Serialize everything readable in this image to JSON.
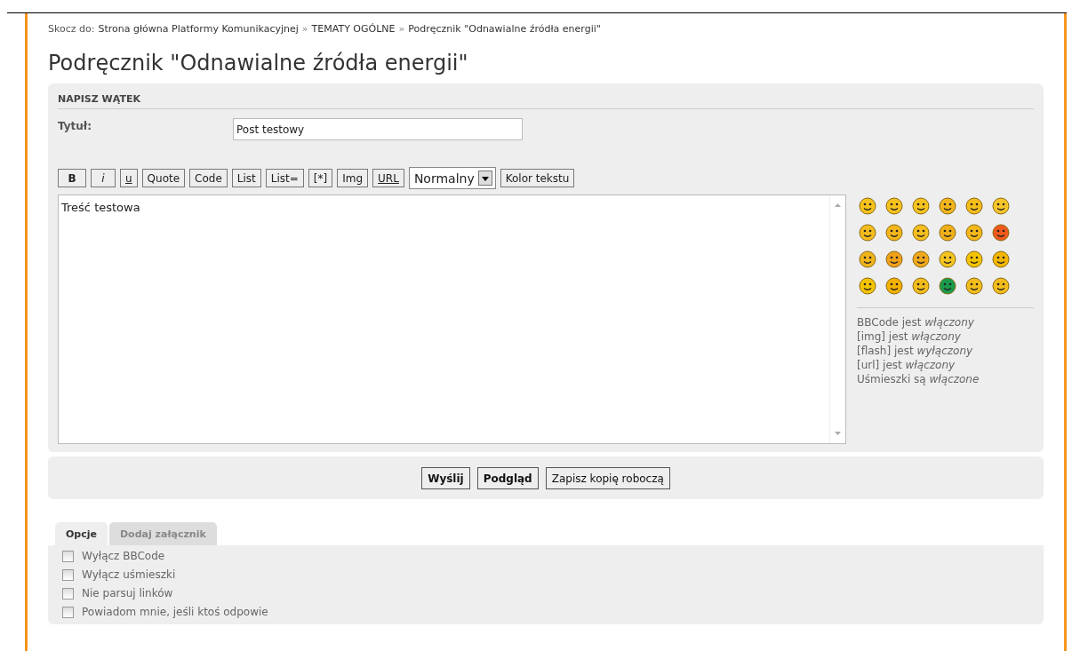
{
  "breadcrumb": {
    "prefix": "Skocz do:",
    "items": [
      "Strona główna Platformy Komunikacyjnej",
      "TEMATY OGÓLNE",
      "Podręcznik \"Odnawialne źródła energii\""
    ],
    "separator": "»"
  },
  "title": "Podręcznik \"Odnawialne źródła energii\"",
  "form": {
    "heading": "NAPISZ WĄTEK",
    "subject_label": "Tytuł:",
    "subject_value": "Post testowy",
    "toolbar": [
      {
        "label": "B",
        "kind": "bold"
      },
      {
        "label": "i",
        "kind": "italic"
      },
      {
        "label": "u",
        "kind": "underline"
      },
      {
        "label": "Quote",
        "kind": "plain"
      },
      {
        "label": "Code",
        "kind": "plain"
      },
      {
        "label": "List",
        "kind": "plain"
      },
      {
        "label": "List=",
        "kind": "plain"
      },
      {
        "label": "[*]",
        "kind": "plain"
      },
      {
        "label": "Img",
        "kind": "plain"
      },
      {
        "label": "URL",
        "kind": "underline"
      }
    ],
    "font_size": "Normalny",
    "color_button": "Kolor tekstu",
    "message": "Treść testowa",
    "status": [
      "BBCode jest *włączony*",
      "[img] jest *włączony*",
      "[flash] jest *wyłączony*",
      "[url] jest *włączony*",
      "Uśmieszki są *włączone*"
    ]
  },
  "actions": [
    {
      "label": "Wyślij",
      "kind": "primary"
    },
    {
      "label": "Podgląd",
      "kind": "primary"
    },
    {
      "label": "Zapisz kopię roboczą",
      "kind": "normal"
    }
  ],
  "tabs": [
    {
      "label": "Opcje",
      "selected": true
    },
    {
      "label": "Dodaj załącznik",
      "selected": false
    }
  ],
  "options": [
    {
      "label": "Wyłącz BBCode",
      "checked": false
    },
    {
      "label": "Wyłącz uśmieszki",
      "checked": false
    },
    {
      "label": "Nie parsuj linków",
      "checked": false
    },
    {
      "label": "Powiadom mnie, jeśli ktoś odpowie",
      "checked": false
    }
  ]
}
